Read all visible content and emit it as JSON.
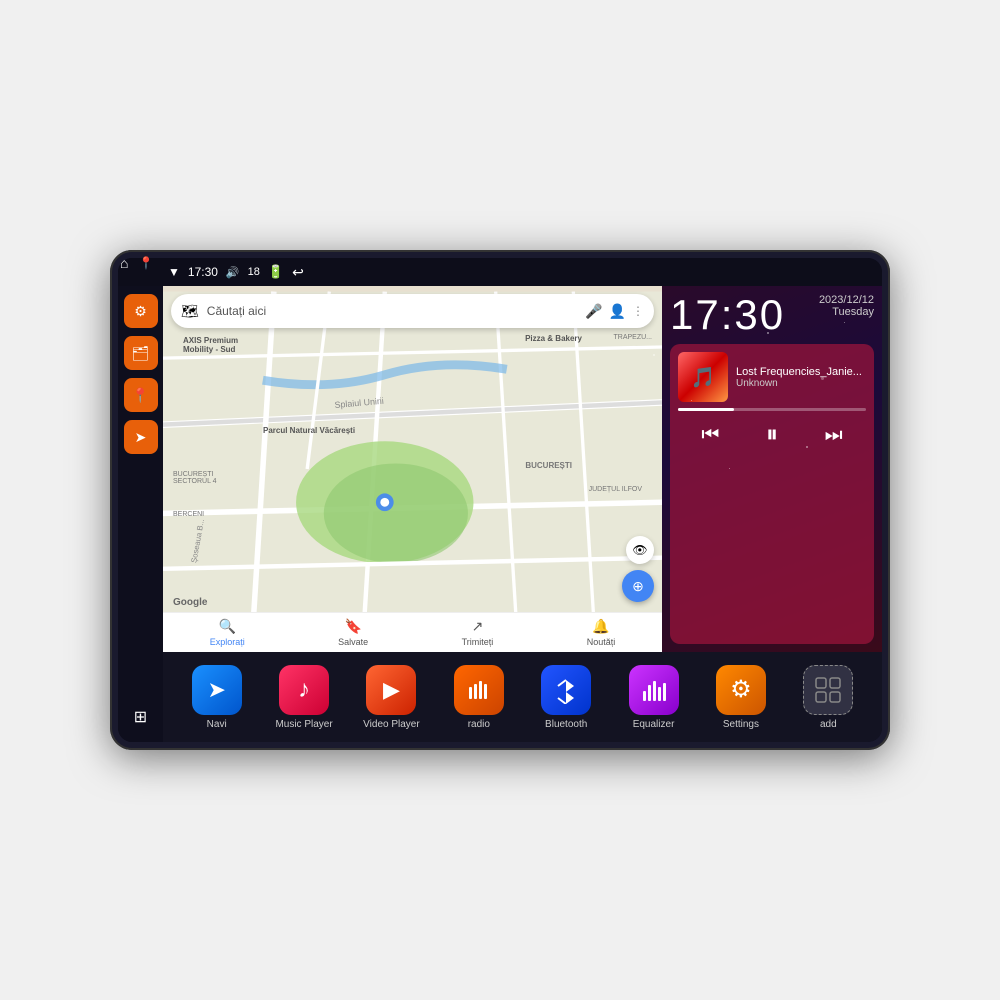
{
  "device": {
    "status_bar": {
      "time": "17:30",
      "battery": "18",
      "home_label": "⌂",
      "maps_label": "📍"
    },
    "date": {
      "year_month_day": "2023/12/12",
      "weekday": "Tuesday"
    },
    "time_display": "17:30",
    "sidebar": {
      "items": [
        {
          "id": "settings",
          "icon": "⚙",
          "color": "orange",
          "label": "Settings"
        },
        {
          "id": "files",
          "icon": "🗂",
          "color": "orange",
          "label": "Files"
        },
        {
          "id": "maps",
          "icon": "📍",
          "color": "orange",
          "label": "Maps"
        },
        {
          "id": "navi",
          "icon": "➤",
          "color": "orange",
          "label": "Navigation"
        }
      ],
      "grid_icon": "⊞"
    },
    "map": {
      "search_placeholder": "Căutați aici",
      "bottom_tabs": [
        {
          "id": "explore",
          "label": "Explorați",
          "icon": "🔍",
          "active": true
        },
        {
          "id": "saved",
          "label": "Salvate",
          "icon": "🔖",
          "active": false
        },
        {
          "id": "share",
          "label": "Trimiteți",
          "icon": "↗",
          "active": false
        },
        {
          "id": "news",
          "label": "Noutăți",
          "icon": "🔔",
          "active": false
        }
      ],
      "labels": [
        "AXIS Premium Mobility - Sud",
        "Pizza & Bakery",
        "Parcul Natural Văcărești",
        "BUCUREȘTI SECTORUL 4",
        "BERCENI",
        "BUCUREȘTI",
        "JUDEȚUL ILFOV",
        "TRAPEZULUI"
      ]
    },
    "music_player": {
      "title": "Lost Frequencies_Janie...",
      "artist": "Unknown",
      "progress_percent": 30,
      "controls": {
        "prev": "⏮",
        "play_pause": "⏸",
        "next": "⏭"
      }
    },
    "apps": [
      {
        "id": "navi",
        "label": "Navi",
        "icon": "➤",
        "color_class": "app-navi"
      },
      {
        "id": "music-player",
        "label": "Music Player",
        "icon": "♪",
        "color_class": "app-music"
      },
      {
        "id": "video-player",
        "label": "Video Player",
        "icon": "▶",
        "color_class": "app-video"
      },
      {
        "id": "radio",
        "label": "radio",
        "icon": "📻",
        "color_class": "app-radio"
      },
      {
        "id": "bluetooth",
        "label": "Bluetooth",
        "icon": "⚡",
        "color_class": "app-bluetooth"
      },
      {
        "id": "equalizer",
        "label": "Equalizer",
        "icon": "🎚",
        "color_class": "app-equalizer"
      },
      {
        "id": "settings",
        "label": "Settings",
        "icon": "⚙",
        "color_class": "app-settings"
      },
      {
        "id": "add",
        "label": "add",
        "icon": "+",
        "color_class": "app-add"
      }
    ]
  }
}
